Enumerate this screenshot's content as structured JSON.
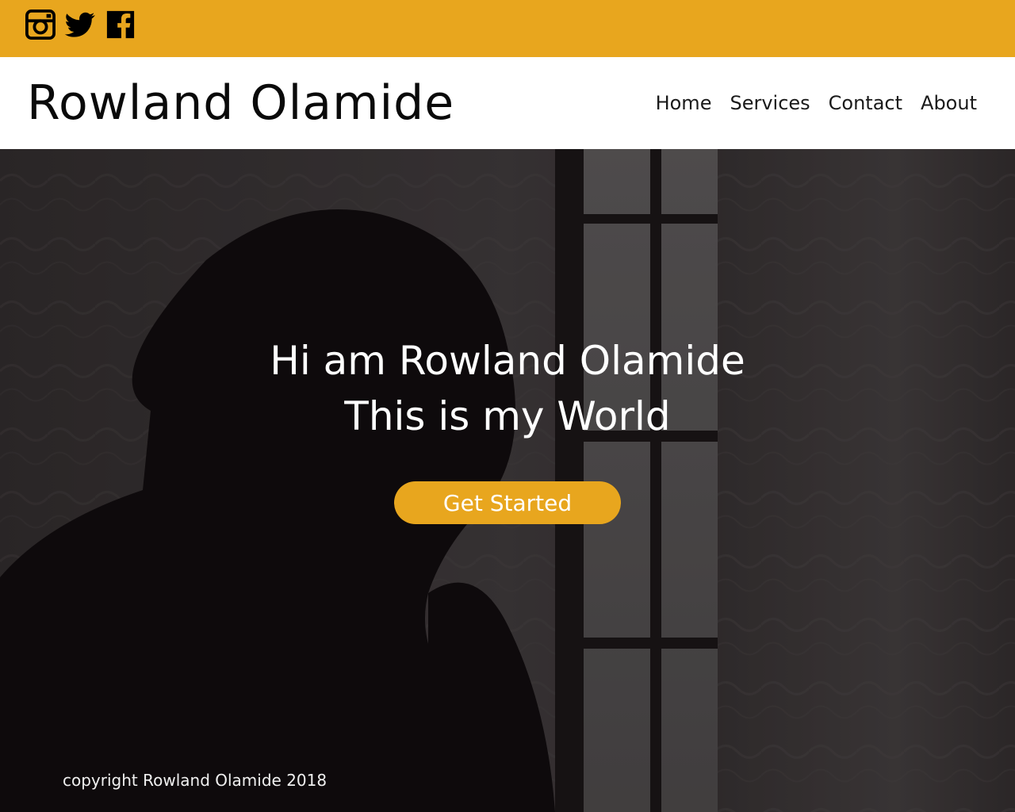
{
  "colors": {
    "accent": "#e8a61e",
    "header_bg": "#ffffff",
    "hero_text": "#ffffff"
  },
  "social": {
    "icons": [
      "instagram-icon",
      "twitter-icon",
      "facebook-icon"
    ]
  },
  "header": {
    "brand": "Rowland Olamide",
    "nav": [
      "Home",
      "Services",
      "Contact",
      "About"
    ]
  },
  "hero": {
    "headline_line1": "Hi am Rowland Olamide",
    "headline_line2": "This is my World",
    "cta_label": "Get Started",
    "footer_text": "copyright Rowland Olamide 2018"
  }
}
